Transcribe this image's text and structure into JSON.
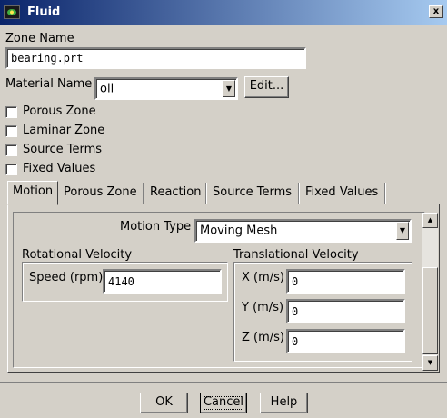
{
  "window": {
    "title": "Fluid",
    "close_label": "x"
  },
  "zone": {
    "label": "Zone Name",
    "value": "bearing.prt"
  },
  "material": {
    "label": "Material Name",
    "value": "oil",
    "edit_label": "Edit..."
  },
  "checkboxes": [
    {
      "label": "Porous Zone",
      "checked": false
    },
    {
      "label": "Laminar Zone",
      "checked": false
    },
    {
      "label": "Source Terms",
      "checked": false
    },
    {
      "label": "Fixed Values",
      "checked": false
    }
  ],
  "tabs": [
    {
      "label": "Motion",
      "active": true
    },
    {
      "label": "Porous Zone",
      "active": false
    },
    {
      "label": "Reaction",
      "active": false
    },
    {
      "label": "Source Terms",
      "active": false
    },
    {
      "label": "Fixed Values",
      "active": false
    }
  ],
  "motion": {
    "type_label": "Motion Type",
    "type_value": "Moving Mesh",
    "rotational": {
      "title": "Rotational Velocity",
      "speed_label": "Speed (rpm)",
      "speed_value": "4140"
    },
    "translational": {
      "title": "Translational Velocity",
      "x_label": "X (m/s)",
      "x_value": "0",
      "y_label": "Y (m/s)",
      "y_value": "0",
      "z_label": "Z (m/s)",
      "z_value": "0"
    }
  },
  "buttons": {
    "ok": "OK",
    "cancel": "Cancel",
    "help": "Help"
  },
  "icons": {
    "app": "fluent-app-icon",
    "close": "close-icon",
    "dropdown": "chevron-down-icon",
    "scroll_up": "arrow-up-icon",
    "scroll_down": "arrow-down-icon"
  }
}
